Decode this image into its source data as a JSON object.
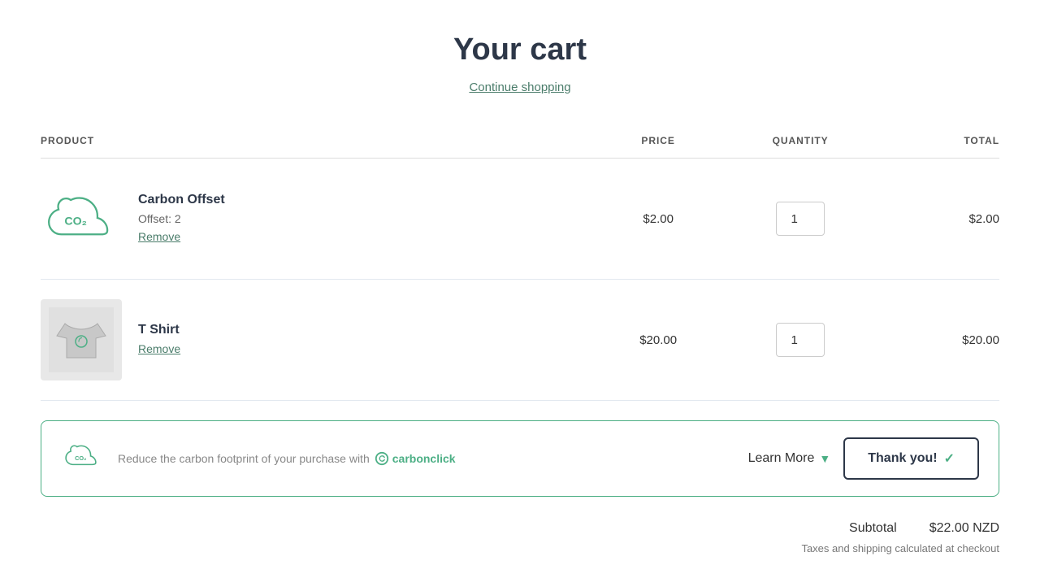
{
  "page": {
    "title": "Your cart",
    "continue_shopping": "Continue shopping"
  },
  "table": {
    "headers": {
      "product": "PRODUCT",
      "price": "PRICE",
      "quantity": "QUANTITY",
      "total": "TOTAL"
    }
  },
  "cart_items": [
    {
      "id": "carbon-offset",
      "name": "Carbon Offset",
      "meta": "Offset: 2",
      "remove": "Remove",
      "price": "$2.00",
      "quantity": 1,
      "total": "$2.00",
      "type": "co2"
    },
    {
      "id": "tshirt",
      "name": "T Shirt",
      "meta": "",
      "remove": "Remove",
      "price": "$20.00",
      "quantity": 1,
      "total": "$20.00",
      "type": "tshirt"
    }
  ],
  "carbon_banner": {
    "text_before": "Reduce the carbon footprint of your purchase with",
    "brand": "carbonclick",
    "learn_more": "Learn More",
    "thank_you": "Thank you!"
  },
  "subtotal": {
    "label": "Subtotal",
    "value": "$22.00 NZD",
    "tax_note": "Taxes and shipping calculated at checkout"
  }
}
